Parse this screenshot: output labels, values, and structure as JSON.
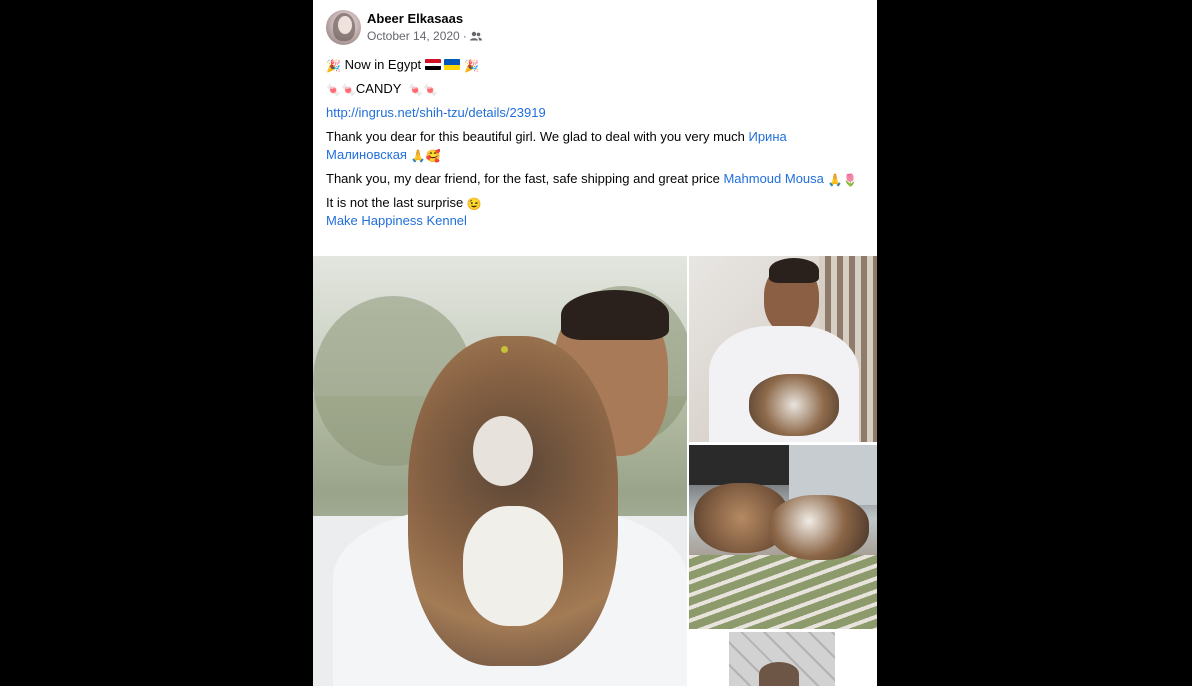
{
  "post": {
    "author": "Abeer Elkasaas",
    "date": "October 14, 2020",
    "separator": "·",
    "audience_icon": "friends-icon"
  },
  "text": {
    "line1": "Now in Egypt",
    "line2": "CANDY",
    "url": "http://ingrus.net/shih-tzu/details/23919",
    "thanks1_prefix": "Thank you dear for this beautiful girl. We glad to deal with you very much ",
    "thanks1_mention": "Ирина Малиновская",
    "thanks2_prefix": "Thank you, my dear friend, for the fast, safe shipping and great price ",
    "thanks2_mention": "Mahmoud Mousa",
    "surprise": "It is not the last surprise",
    "kennel": "Make Happiness Kennel"
  },
  "colors": {
    "link": "#216fdb",
    "meta": "#65676b",
    "text": "#050505"
  },
  "photos": {
    "count": 4,
    "main_alt": "man holding shih tzu puppy",
    "right1_alt": "man sleeping in hammock with puppy",
    "right2_alt": "puppies sleeping in hammock",
    "right3_alt": "puppy on tiles"
  }
}
